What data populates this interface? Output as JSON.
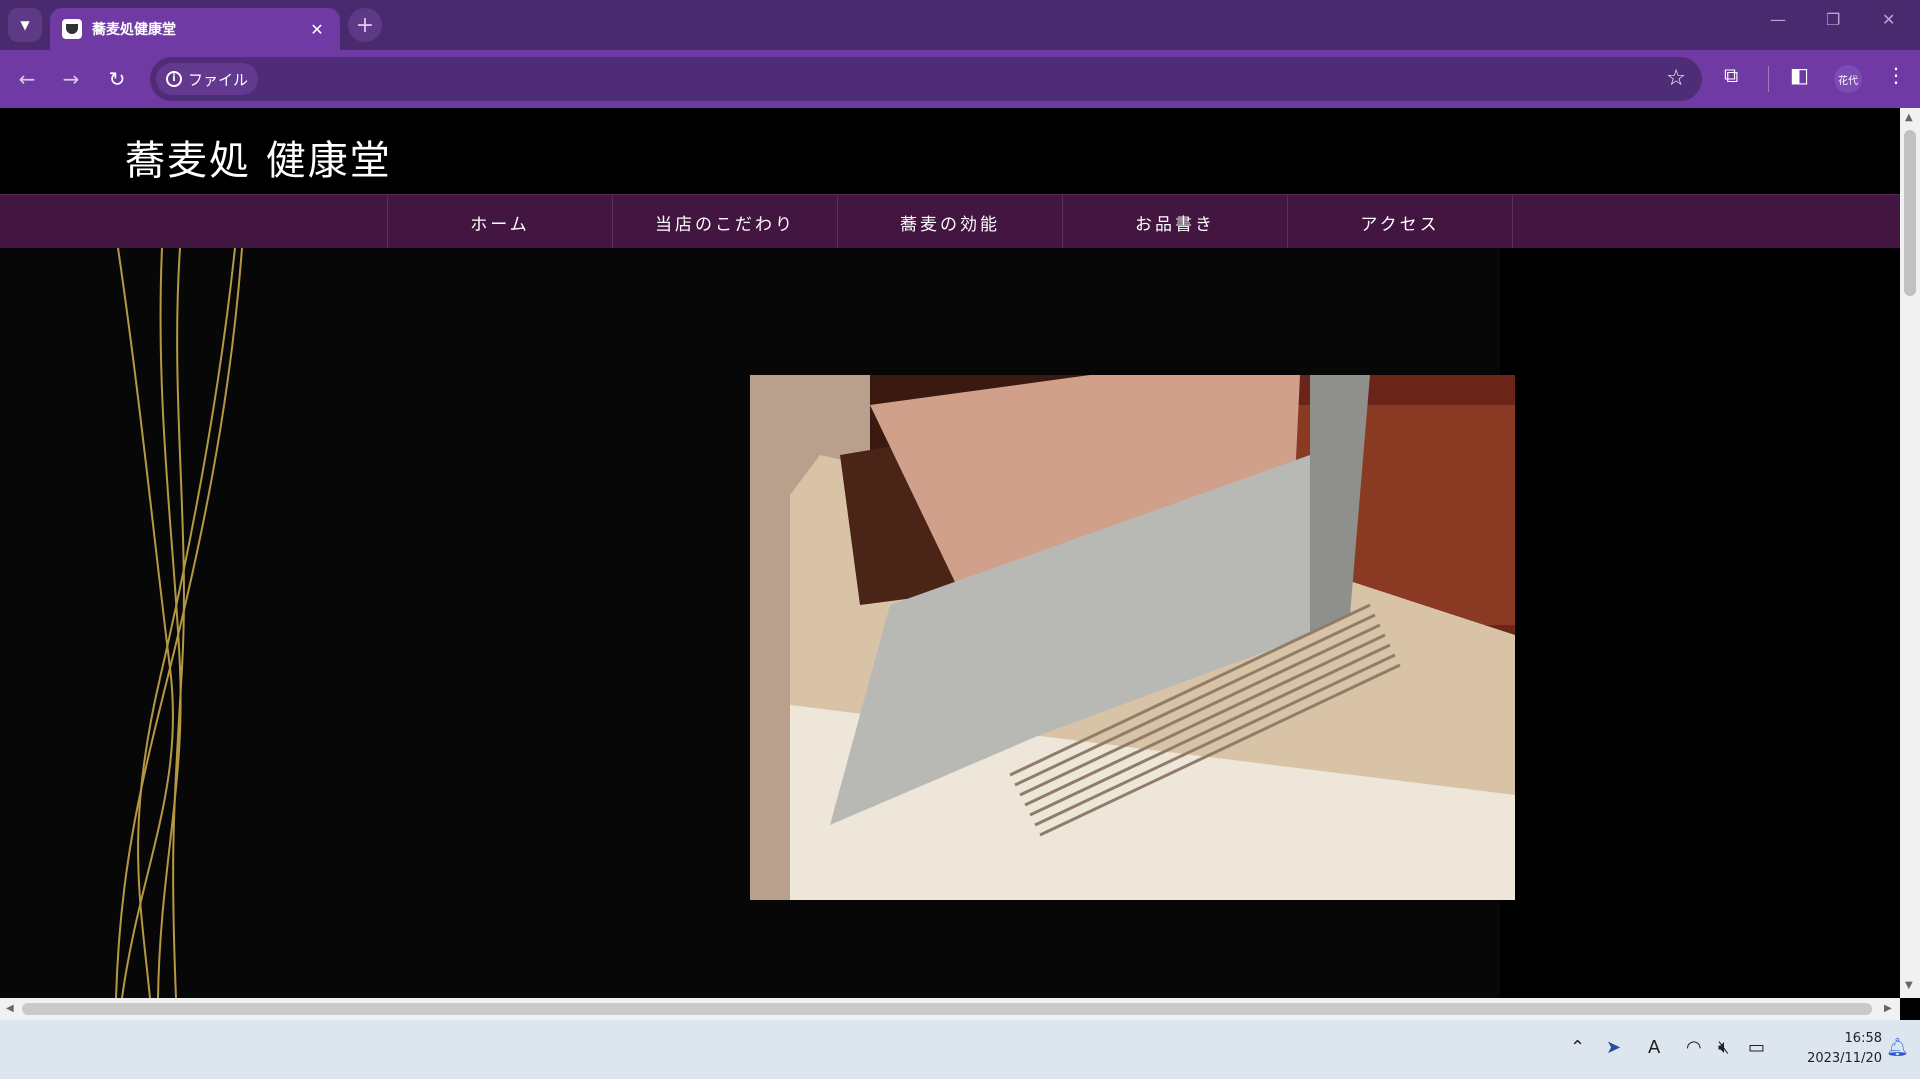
{
  "browser": {
    "tab_title": "蕎麦処健康堂",
    "address_chip": "ファイル",
    "profile_label": "花代"
  },
  "site": {
    "title": "蕎麦処 健康堂",
    "nav": [
      {
        "label": "ホーム"
      },
      {
        "label": "当店のこだわり"
      },
      {
        "label": "蕎麦の効能"
      },
      {
        "label": "お品書き"
      },
      {
        "label": "アクセス"
      }
    ]
  },
  "taskbar": {
    "time": "16:58",
    "date": "2023/11/20"
  },
  "colors": {
    "chrome_tabbar": "#4a2a6e",
    "chrome_toolbar": "#6f3aa3",
    "site_nav": "#421640",
    "gold": "#c8a84a"
  },
  "icons": {
    "tab_search": "chevron-down-icon",
    "new_tab": "plus-icon",
    "back": "arrow-left-icon",
    "forward": "arrow-right-icon",
    "reload": "reload-icon",
    "site_info": "info-icon",
    "bookmark": "star-icon",
    "extensions": "puzzle-icon",
    "side_panel": "side-panel-icon",
    "menu": "kebab-icon"
  }
}
